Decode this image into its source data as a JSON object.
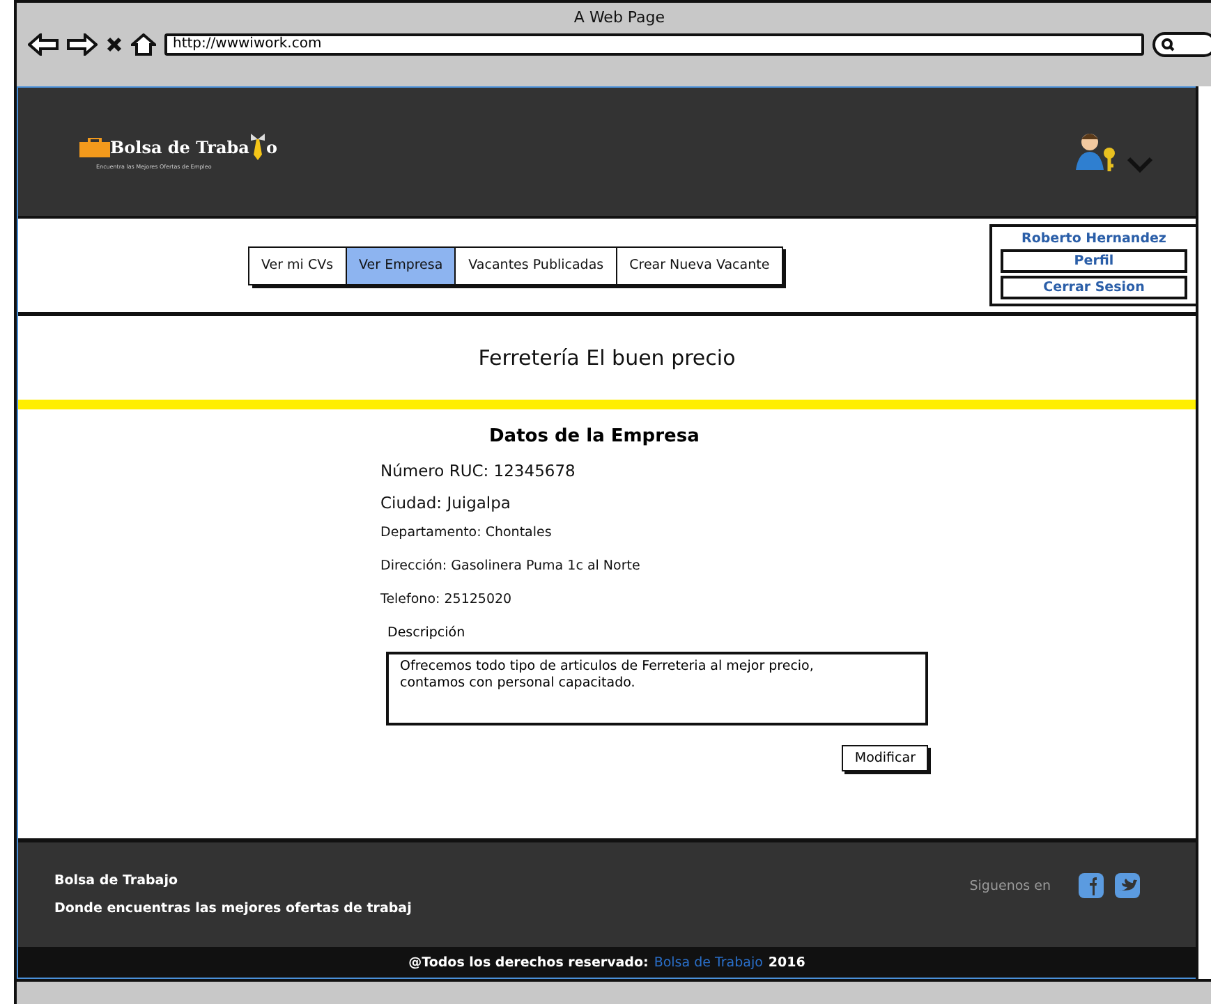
{
  "window": {
    "title": "A Web Page",
    "url": "http://wwwiwork.com"
  },
  "header": {
    "logo_text_before": "Bolsa de Traba",
    "logo_text_after": "o",
    "logo_tagline": "Encuentra las Mejores Ofertas de Empleo"
  },
  "tabs": [
    {
      "label": "Ver mi CVs",
      "selected": false
    },
    {
      "label": "Ver Empresa",
      "selected": true
    },
    {
      "label": "Vacantes Publicadas",
      "selected": false
    },
    {
      "label": "Crear Nueva Vacante",
      "selected": false
    }
  ],
  "user_menu": {
    "name": "Roberto Hernandez",
    "items": [
      "Perfil",
      "Cerrar Sesion"
    ]
  },
  "company_name": "Ferretería El buen precio",
  "section_title": "Datos de la Empresa",
  "fields": [
    {
      "text": "Número RUC: 12345678",
      "kind": "large"
    },
    {
      "text": "Ciudad: Juigalpa",
      "kind": "large"
    },
    {
      "text": "Departamento: Chontales",
      "kind": "small"
    },
    {
      "text": "Dirección: Gasolinera Puma 1c al Norte",
      "kind": "small"
    },
    {
      "text": "Telefono: 25125020",
      "kind": "small"
    }
  ],
  "description_label": "Descripción",
  "description": "Ofrecemos todo tipo de articulos de Ferreteria al mejor precio, contamos con personal capacitado.",
  "modify_button": "Modificar",
  "footer": {
    "brand": "Bolsa de Trabajo",
    "slogan": "Donde  encuentras las mejores ofertas de trabaj",
    "follow": "Siguenos en",
    "copyright_prefix": "@Todos los derechos reservado:",
    "copyright_link": "Bolsa de Trabajo",
    "copyright_year": "2016"
  }
}
